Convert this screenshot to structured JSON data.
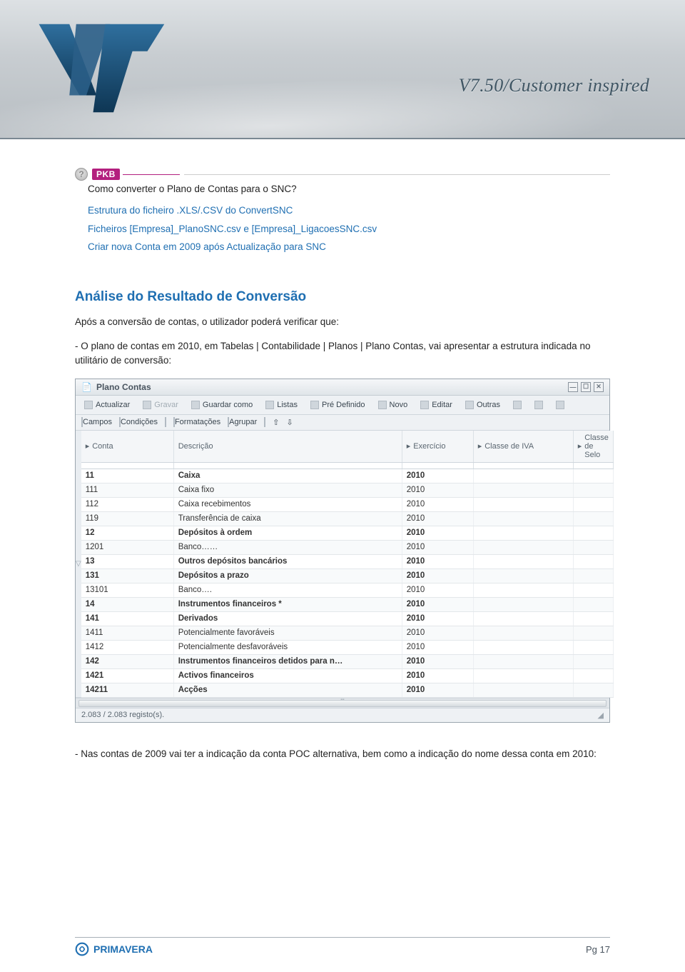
{
  "banner": {
    "tagline": "V7.50/Customer inspired"
  },
  "pkb": {
    "badge": "PKB",
    "title": "Como converter o Plano de Contas para o SNC?"
  },
  "toc": {
    "items": [
      "Estrutura do ficheiro .XLS/.CSV do ConvertSNC",
      "Ficheiros [Empresa]_PlanoSNC.csv e [Empresa]_LigacoesSNC.csv",
      "Criar nova Conta em 2009 após Actualização para SNC"
    ]
  },
  "section_heading": "Análise do Resultado de Conversão",
  "para1": "Após a conversão de contas, o utilizador poderá verificar que:",
  "para2": "- O plano de contas em 2010, em Tabelas | Contabilidade | Planos | Plano Contas, vai apresentar a estrutura indicada no utilitário de conversão:",
  "para3": "- Nas contas de 2009 vai ter a indicação da conta POC alternativa, bem como a indicação do nome dessa conta em 2010:",
  "app": {
    "title": "Plano Contas",
    "toolbar1": [
      "Actualizar",
      "Gravar",
      "Guardar como",
      "Listas",
      "Pré Definido",
      "Novo",
      "Editar",
      "Outras"
    ],
    "toolbar2": [
      "Campos",
      "Condições",
      "Formatações",
      "Agrupar"
    ],
    "columns": [
      "Conta",
      "Descrição",
      "Exercício",
      "Classe de IVA",
      "Classe de Selo"
    ],
    "rows": [
      {
        "bold": true,
        "conta": "11",
        "desc": "Caixa",
        "ex": "2010"
      },
      {
        "bold": false,
        "conta": "111",
        "desc": "Caixa fixo",
        "ex": "2010"
      },
      {
        "bold": false,
        "conta": "112",
        "desc": "Caixa recebimentos",
        "ex": "2010"
      },
      {
        "bold": false,
        "conta": "119",
        "desc": "Transferência de caixa",
        "ex": "2010"
      },
      {
        "bold": true,
        "conta": "12",
        "desc": "Depósitos à ordem",
        "ex": "2010"
      },
      {
        "bold": false,
        "conta": "1201",
        "desc": "Banco……",
        "ex": "2010"
      },
      {
        "bold": true,
        "conta": "13",
        "desc": "Outros depósitos bancários",
        "ex": "2010"
      },
      {
        "bold": true,
        "conta": "131",
        "desc": "Depósitos a prazo",
        "ex": "2010"
      },
      {
        "bold": false,
        "conta": "13101",
        "desc": "Banco….",
        "ex": "2010"
      },
      {
        "bold": true,
        "conta": "14",
        "desc": "Instrumentos financeiros *",
        "ex": "2010"
      },
      {
        "bold": true,
        "conta": "141",
        "desc": "Derivados",
        "ex": "2010"
      },
      {
        "bold": false,
        "conta": "1411",
        "desc": "Potencialmente favoráveis",
        "ex": "2010"
      },
      {
        "bold": false,
        "conta": "1412",
        "desc": "Potencialmente desfavoráveis",
        "ex": "2010"
      },
      {
        "bold": true,
        "conta": "142",
        "desc": "Instrumentos financeiros detidos para n…",
        "ex": "2010"
      },
      {
        "bold": true,
        "conta": "1421",
        "desc": "Activos financeiros",
        "ex": "2010"
      },
      {
        "bold": true,
        "conta": "14211",
        "desc": "Acções",
        "ex": "2010"
      }
    ],
    "status": "2.083 / 2.083 registo(s)."
  },
  "footer": {
    "brand": "PRIMAVERA",
    "page": "Pg 17"
  }
}
